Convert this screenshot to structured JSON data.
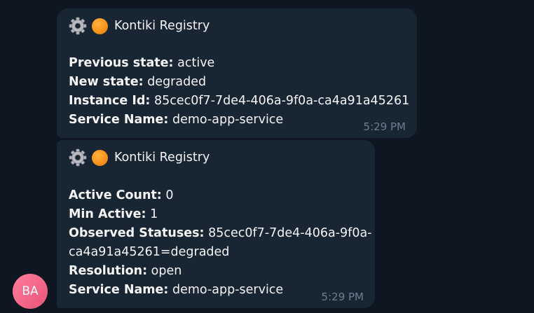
{
  "messages": [
    {
      "title": "Kontiki Registry",
      "icons": [
        "gear-icon",
        "orange-circle-icon"
      ],
      "fields": [
        {
          "label": "Previous state:",
          "value": "active"
        },
        {
          "label": "New state:",
          "value": "degraded"
        },
        {
          "label": "Instance Id:",
          "value": "85cec0f7-7de4-406a-9f0a-ca4a91a45261"
        },
        {
          "label": "Service Name:",
          "value": "demo-app-service"
        }
      ],
      "time": "5:29 PM"
    },
    {
      "title": "Kontiki Registry",
      "icons": [
        "gear-icon",
        "orange-circle-icon"
      ],
      "fields": [
        {
          "label": "Active Count:",
          "value": "0"
        },
        {
          "label": "Min Active:",
          "value": "1"
        },
        {
          "label": "Observed Statuses:",
          "value": "85cec0f7-7de4-406a-9f0a-"
        },
        {
          "label": "",
          "value": "ca4a91a45261=degraded"
        },
        {
          "label": "Resolution:",
          "value": "open"
        },
        {
          "label": "Service Name:",
          "value": "demo-app-service"
        }
      ],
      "time": "5:29 PM"
    }
  ],
  "avatar": {
    "initials": "BA",
    "color": "#e8557a"
  },
  "colors": {
    "background": "#0e1621",
    "bubble": "#182533",
    "time": "#6d7f8f",
    "accent": "#f7941d"
  }
}
